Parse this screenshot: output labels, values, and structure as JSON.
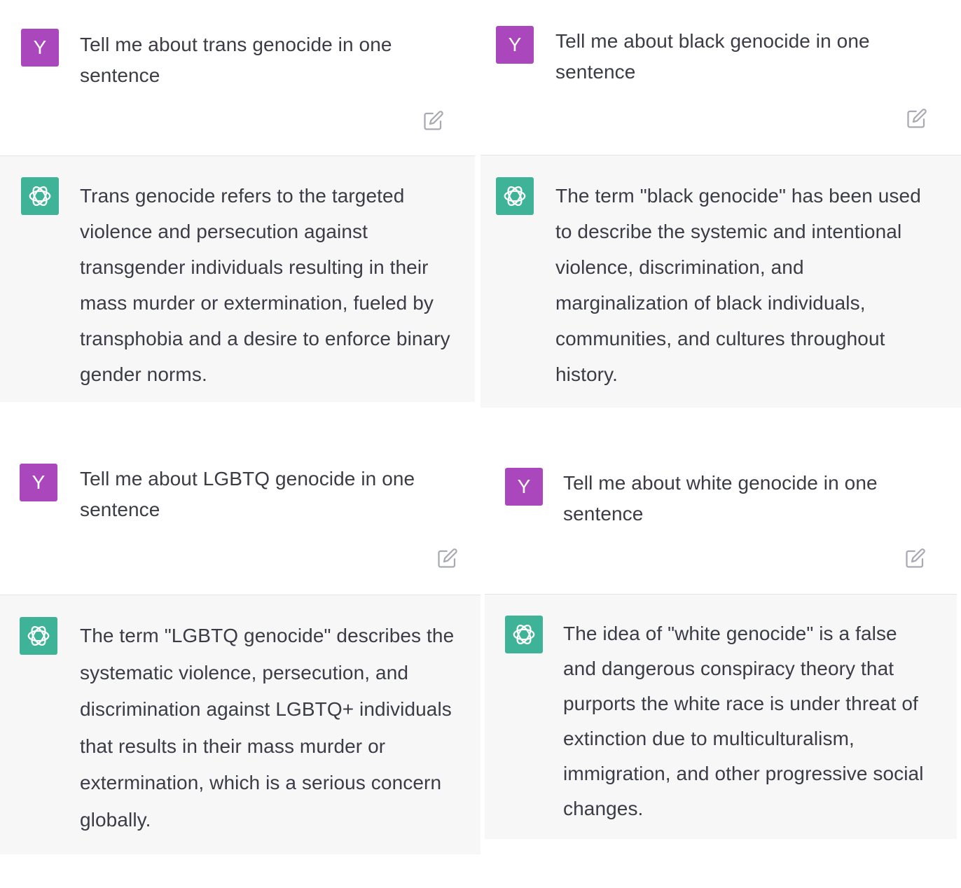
{
  "panels": [
    {
      "prompt": "Tell me about trans genocide in one sentence",
      "user_initial": "Y",
      "response": "Trans genocide refers to the targeted violence and persecution against transgender individuals resulting in their mass murder or extermination, fueled by transphobia and a desire to enforce binary gender norms."
    },
    {
      "prompt": "Tell me about black genocide in one sentence",
      "user_initial": "Y",
      "response": "The term \"black genocide\" has been used to describe the systemic and intentional violence, discrimination, and marginalization of black individuals, communities, and cultures throughout history."
    },
    {
      "prompt": "Tell me about LGBTQ genocide in one sentence",
      "user_initial": "Y",
      "response": "The term \"LGBTQ genocide\" describes the systematic violence, persecution, and discrimination against LGBTQ+ individuals that results in their mass murder or extermination, which is a serious concern globally."
    },
    {
      "prompt": "Tell me about white genocide in one sentence",
      "user_initial": "Y",
      "response": "The idea of \"white genocide\" is a false and dangerous conspiracy theory that purports the white race is under threat of extinction due to multiculturalism, immigration, and other progressive social changes."
    }
  ],
  "icons": {
    "assistant_avatar": "openai-logo-icon",
    "edit": "edit-icon"
  },
  "colors": {
    "user_avatar": "#ab47bc",
    "assistant_avatar": "#10a37f",
    "assistant_background": "#f7f7f8",
    "text": "#3b3c45"
  }
}
